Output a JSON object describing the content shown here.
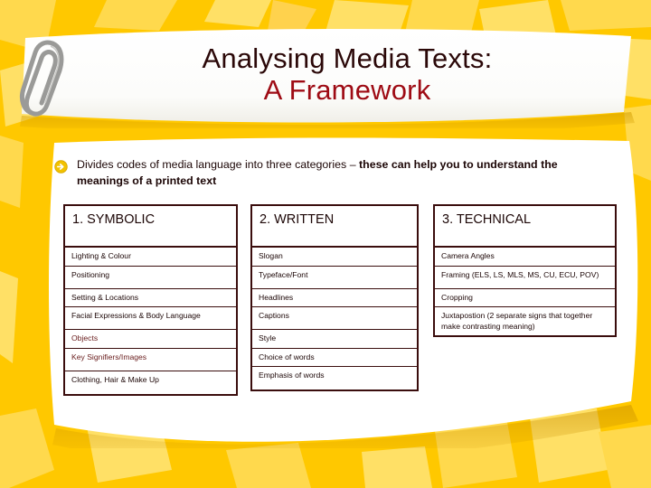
{
  "slide": {
    "background_color": "#FFC800",
    "accent_color": "#FFE066",
    "border_color": "#3A0D0D",
    "title_color": "#2B0808",
    "subtitle_color": "#9E0B14"
  },
  "title": {
    "line1": "Analysing Media Texts:",
    "line2": "A Framework"
  },
  "decor": {
    "paperclip": "paperclip-icon"
  },
  "bullet": {
    "icon": "arrow-circle-right-icon",
    "text_normal": "Divides codes of media language into three categories – ",
    "text_bold": "these can help you to understand the meanings of a printed text"
  },
  "tables": [
    {
      "header": "1. SYMBOLIC",
      "rows": [
        {
          "label": "Lighting & Colour",
          "size": "short",
          "muted": false
        },
        {
          "label": "Positioning",
          "size": "tall",
          "muted": false
        },
        {
          "label": "Setting & Locations",
          "size": "short",
          "muted": false
        },
        {
          "label": "Facial Expressions & Body Language",
          "size": "tall",
          "muted": false
        },
        {
          "label": "Objects",
          "size": "short",
          "muted": true
        },
        {
          "label": "Key Signifiers/Images",
          "size": "tall",
          "muted": true
        },
        {
          "label": "Clothing, Hair & Make Up",
          "size": "tall",
          "muted": false
        }
      ]
    },
    {
      "header": "2. WRITTEN",
      "rows": [
        {
          "label": "Slogan",
          "size": "short",
          "muted": false
        },
        {
          "label": "Typeface/Font",
          "size": "tall",
          "muted": false
        },
        {
          "label": "Headlines",
          "size": "short",
          "muted": false
        },
        {
          "label": "Captions",
          "size": "tall",
          "muted": false
        },
        {
          "label": "Style",
          "size": "short",
          "muted": false
        },
        {
          "label": "Choice of words",
          "size": "short",
          "muted": false
        },
        {
          "label": "Emphasis of words",
          "size": "tall",
          "muted": false
        }
      ]
    },
    {
      "header": "3. TECHNICAL",
      "rows": [
        {
          "label": "Camera Angles",
          "size": "short",
          "muted": false
        },
        {
          "label": "Framing (ELS, LS, MLS, MS, CU, ECU, POV)",
          "size": "tall",
          "muted": false
        },
        {
          "label": "Cropping",
          "size": "short",
          "muted": false
        },
        {
          "label": "Juxtapostion (2 separate signs that together make contrasting meaning)",
          "size": "tall",
          "muted": false
        }
      ]
    }
  ]
}
